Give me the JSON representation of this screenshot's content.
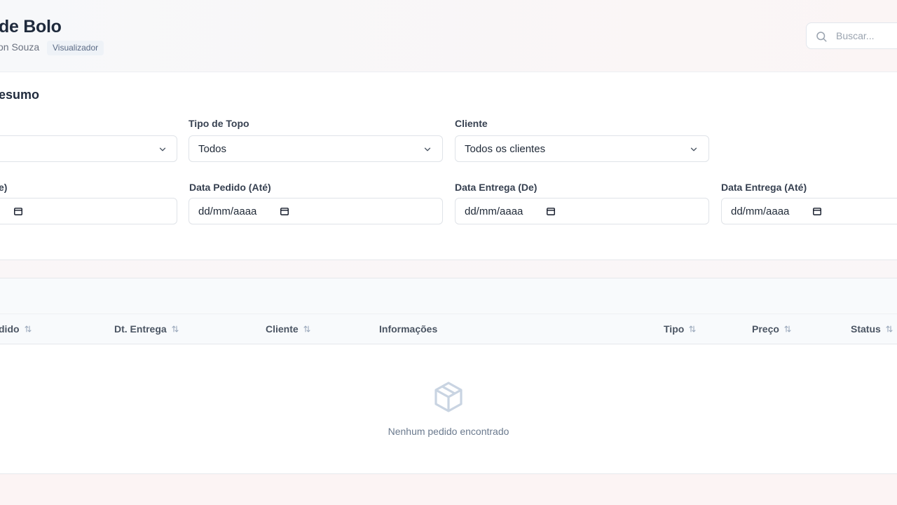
{
  "header": {
    "title": "de Bolo",
    "user_name": "on Souza",
    "role": "Visualizador"
  },
  "search": {
    "placeholder": "Buscar..."
  },
  "filters": {
    "section_title": "esumo",
    "tipo_topo": {
      "label": "Tipo de Topo",
      "value": "Todos"
    },
    "cliente": {
      "label": "Cliente",
      "value": "Todos os clientes"
    },
    "data_pedido_de": {
      "label": "e)"
    },
    "data_pedido_ate": {
      "label": "Data Pedido (Até)",
      "placeholder": "dd/mm/aaaa"
    },
    "data_entrega_de": {
      "label": "Data Entrega (De)",
      "placeholder": "dd/mm/aaaa"
    },
    "data_entrega_ate": {
      "label": "Data Entrega (Até)",
      "placeholder": "dd/mm/aaaa"
    }
  },
  "table": {
    "columns": [
      "dido",
      "Dt. Entrega",
      "Cliente",
      "Informações",
      "Tipo",
      "Preço",
      "Status"
    ],
    "rows": [],
    "empty_message": "Nenhum pedido encontrado"
  },
  "icons": {
    "search": "search-icon",
    "chevron": "chevron-down-icon",
    "calendar": "calendar-icon",
    "sort": "sort-icon",
    "empty": "box-icon"
  },
  "colors": {
    "accent_text": "#1f2a3c",
    "muted_text": "#6b7a8e",
    "border": "#dfe3e8",
    "badge_bg": "#eef2f7"
  }
}
